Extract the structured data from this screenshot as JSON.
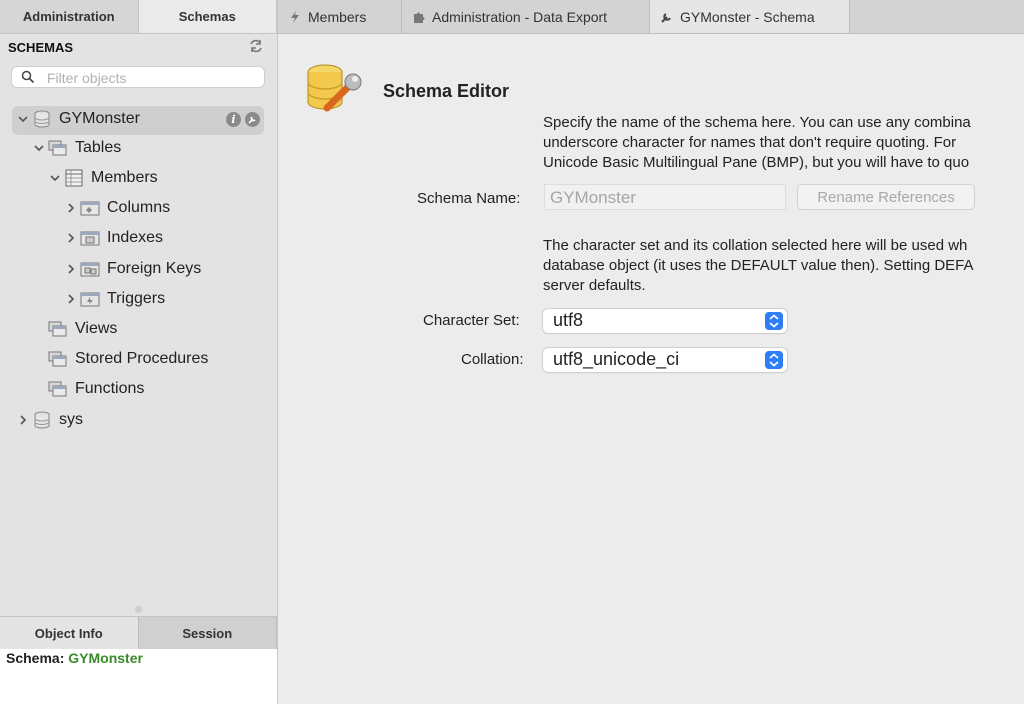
{
  "sidebar": {
    "tabs": [
      "Administration",
      "Schemas"
    ],
    "header": "SCHEMAS",
    "filter_placeholder": "Filter objects",
    "tree": {
      "schema1": "GYMonster",
      "tables": "Tables",
      "members": "Members",
      "columns": "Columns",
      "indexes": "Indexes",
      "foreign_keys": "Foreign Keys",
      "triggers": "Triggers",
      "views": "Views",
      "stored_procedures": "Stored Procedures",
      "functions": "Functions",
      "schema2": "sys"
    },
    "bottom_tabs": [
      "Object Info",
      "Session"
    ],
    "info": {
      "label": "Schema:",
      "value": "GYMonster"
    }
  },
  "doc_tabs": [
    "Members",
    "Administration - Data Export",
    "GYMonster - Schema"
  ],
  "editor": {
    "title": "Schema Editor",
    "desc1": [
      "Specify the name of the schema here. You can use any combina",
      "underscore character for names that don't require quoting. For",
      "Unicode Basic Multilingual Pane (BMP), but you will have to quo"
    ],
    "schema_name_label": "Schema Name:",
    "schema_name_value": "GYMonster",
    "rename_button": "Rename References",
    "desc2": [
      "The character set and its collation selected here will be used wh",
      "database object (it uses the DEFAULT value then). Setting DEFA",
      "server defaults."
    ],
    "charset_label": "Character Set:",
    "charset_value": "utf8",
    "collation_label": "Collation:",
    "collation_value": "utf8_unicode_ci"
  },
  "colors": {
    "accent": "#2f7ef5",
    "info_value": "#3a8a2a"
  }
}
